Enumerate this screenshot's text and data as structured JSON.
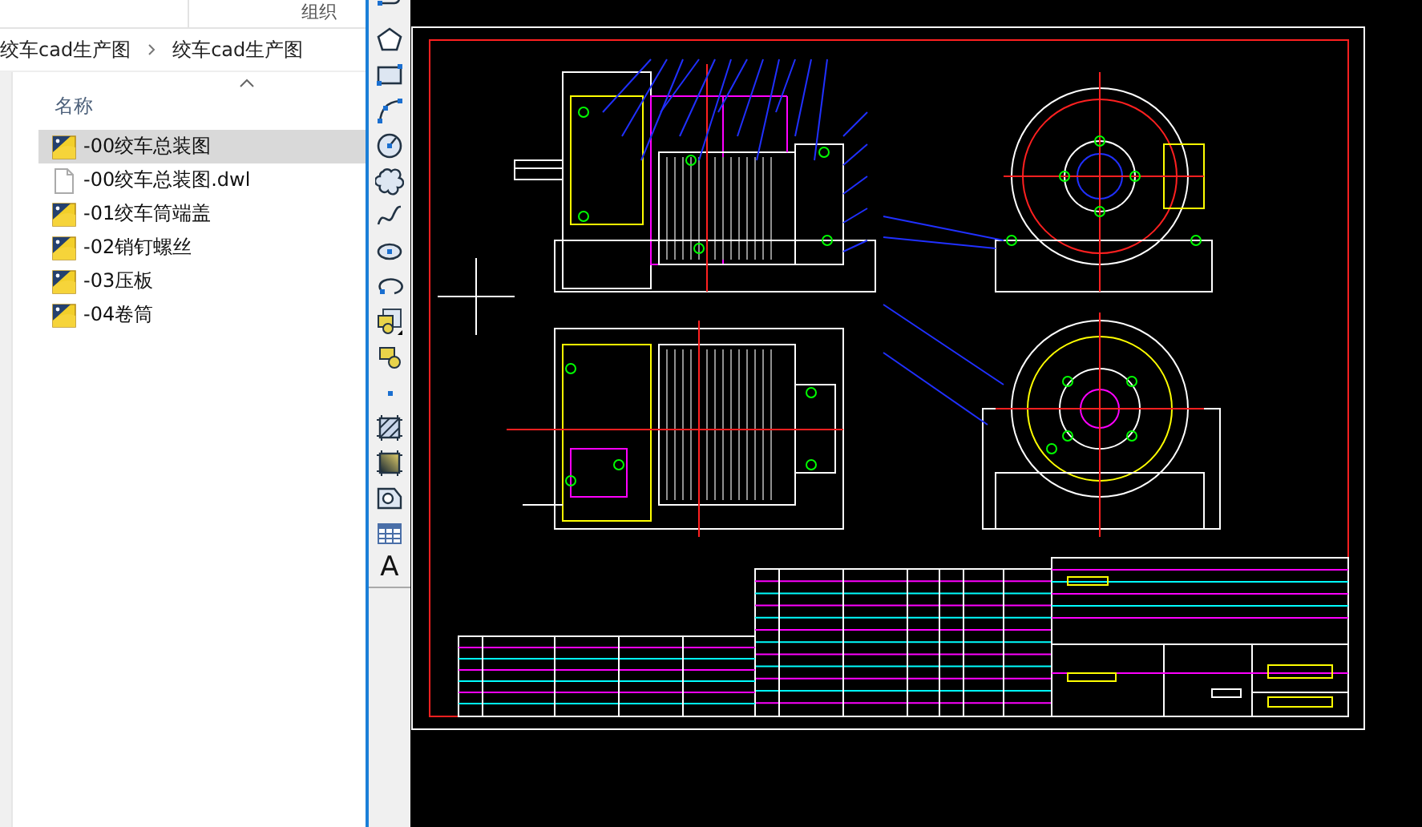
{
  "explorer": {
    "toolbar_label": "组织",
    "breadcrumb": [
      "绞车cad生产图",
      "绞车cad生产图"
    ],
    "column_header": "名称",
    "files": [
      {
        "name": "-00绞车总装图",
        "kind": "dwg",
        "selected": true
      },
      {
        "name": "-00绞车总装图.dwl",
        "kind": "file",
        "selected": false
      },
      {
        "name": "-01绞车筒端盖",
        "kind": "dwg",
        "selected": false
      },
      {
        "name": "-02销钉螺丝",
        "kind": "dwg",
        "selected": false
      },
      {
        "name": "-03压板",
        "kind": "dwg",
        "selected": false
      },
      {
        "name": "-04卷筒",
        "kind": "dwg",
        "selected": false
      }
    ]
  },
  "cad_toolbar": {
    "text_tool": "A"
  }
}
